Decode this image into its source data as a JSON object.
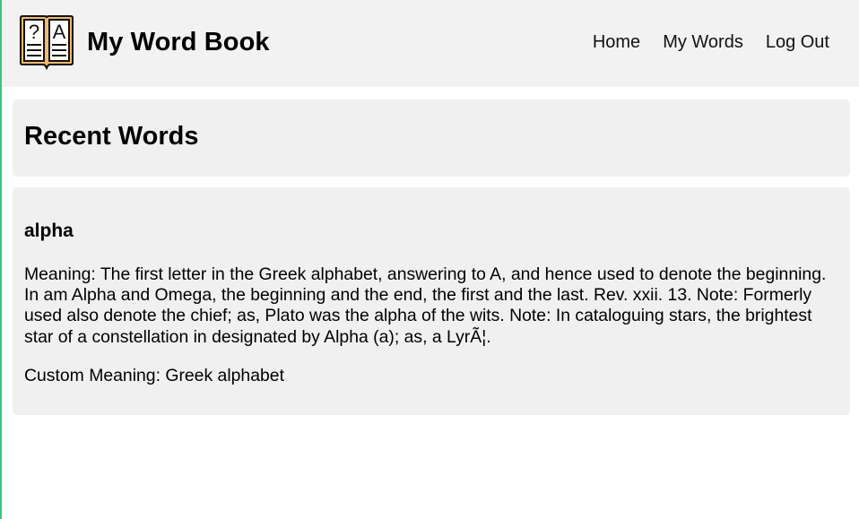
{
  "header": {
    "app_title": "My Word Book",
    "logo_icon": "book-icon",
    "nav": [
      {
        "label": "Home"
      },
      {
        "label": "My Words"
      },
      {
        "label": "Log Out"
      }
    ]
  },
  "main": {
    "heading": "Recent Words",
    "words": [
      {
        "word": "alpha",
        "meaning_label": "Meaning: ",
        "meaning": "The first letter in the Greek alphabet, answering to A, and hence used to denote the beginning. In am Alpha and Omega, the beginning and the end, the first and the last. Rev. xxii. 13. Note: Formerly used also denote the chief; as, Plato was the alpha of the wits. Note: In cataloguing stars, the brightest star of a constellation in designated by Alpha (a); as, a LyrÃ¦.",
        "custom_label": "Custom Meaning: ",
        "custom_meaning": "Greek alphabet"
      }
    ]
  },
  "colors": {
    "accent_border": "#3cc47c",
    "navbar_bg": "#f2f2f2",
    "panel_bg": "#f0f0f0",
    "logo_fill": "#f0b96c"
  }
}
